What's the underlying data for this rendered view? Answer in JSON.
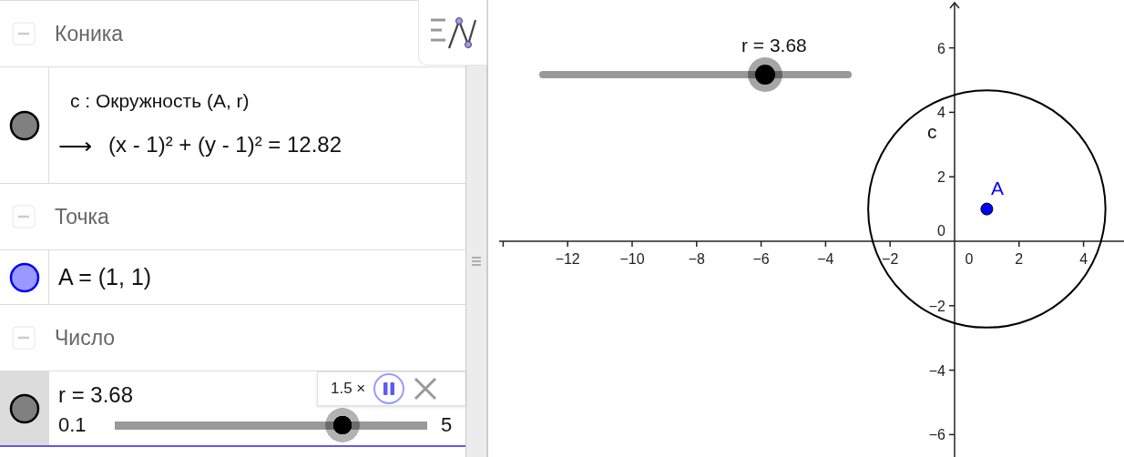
{
  "algebra": {
    "groups": [
      {
        "label": "Коника",
        "expanded": true,
        "items": [
          {
            "kind": "formula",
            "visible": true,
            "selected": false,
            "color": "#808080",
            "definition": "c : Окружность (A, r)",
            "arrow": "⟶",
            "value": "(x - 1)² + (y - 1)² = 12.82"
          }
        ]
      },
      {
        "label": "Точка",
        "expanded": true,
        "items": [
          {
            "kind": "text",
            "visible": true,
            "selected": false,
            "color": "#9999ff",
            "text": "A = (1, 1)"
          }
        ]
      },
      {
        "label": "Число",
        "expanded": true,
        "items": [
          {
            "kind": "slider",
            "visible": true,
            "selected": true,
            "color": "#808080",
            "text": "r = 3.68",
            "min": "0.1",
            "max": "5",
            "level": 0.73
          }
        ]
      }
    ],
    "animation": {
      "speed": "1.5 ×",
      "playing": true
    }
  },
  "graphics": {
    "slider": {
      "label": "r = 3.68"
    },
    "circle_label": "c",
    "point_label": "A",
    "x_ticks": [
      "−12",
      "−10",
      "−8",
      "−6",
      "−4",
      "−2",
      "0",
      "2",
      "4"
    ],
    "y_ticks": [
      "6",
      "4",
      "2",
      "0",
      "−2",
      "−4",
      "−6"
    ]
  }
}
